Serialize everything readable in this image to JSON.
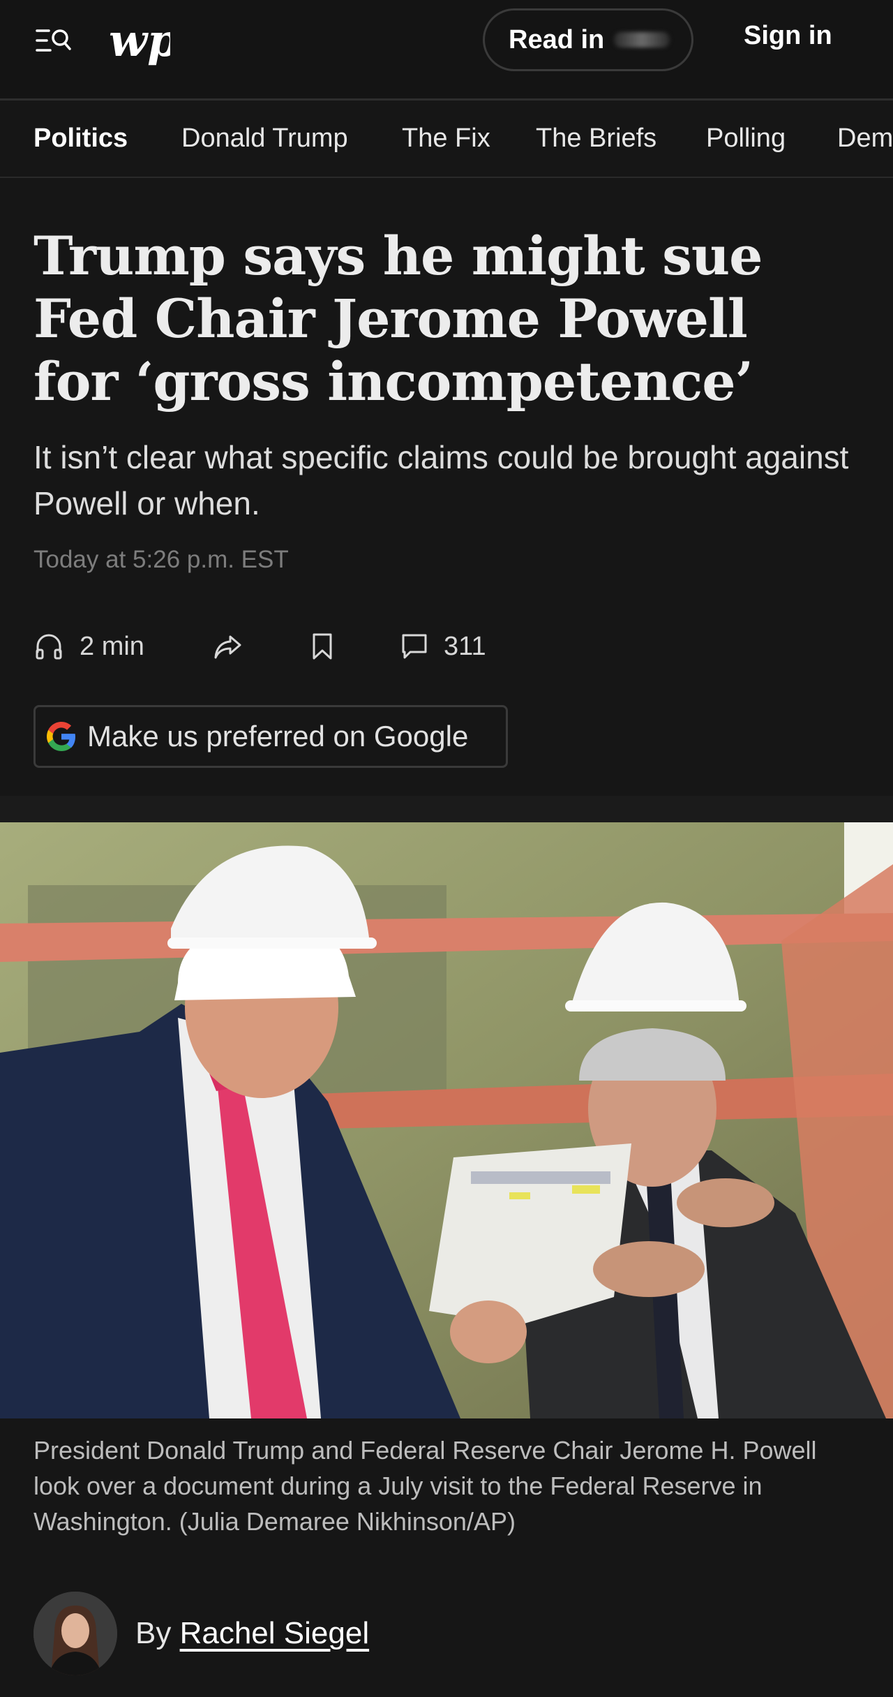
{
  "header": {
    "read_in_label": "Read in",
    "sign_in_label": "Sign in"
  },
  "nav": {
    "items": [
      {
        "label": "Politics",
        "active": true
      },
      {
        "label": "Donald Trump"
      },
      {
        "label": "The Fix"
      },
      {
        "label": "The Briefs"
      },
      {
        "label": "Polling"
      },
      {
        "label": "Dem"
      }
    ]
  },
  "article": {
    "headline": "Trump says he might sue Fed Chair Jerome Powell for ‘gross incompetence’",
    "dek": "It isn’t clear what specific claims could be brought against Powell or when.",
    "timestamp": "Today at 5:26 p.m. EST",
    "listen_label": "2 min",
    "comment_count": "311",
    "google_pref_label": "Make us preferred on Google",
    "caption": "President Donald Trump and Federal Reserve Chair Jerome H. Powell look over a document during a July visit to the Federal Reserve in Washington. (Julia Demaree Nikhinson/AP)",
    "byline_prefix": "By",
    "author": "Rachel Siegel"
  },
  "icons": {
    "menu": "menu-search-icon",
    "listen": "headphones-icon",
    "share": "share-icon",
    "save": "bookmark-icon",
    "comments": "comment-icon",
    "google": "google-g-icon"
  }
}
